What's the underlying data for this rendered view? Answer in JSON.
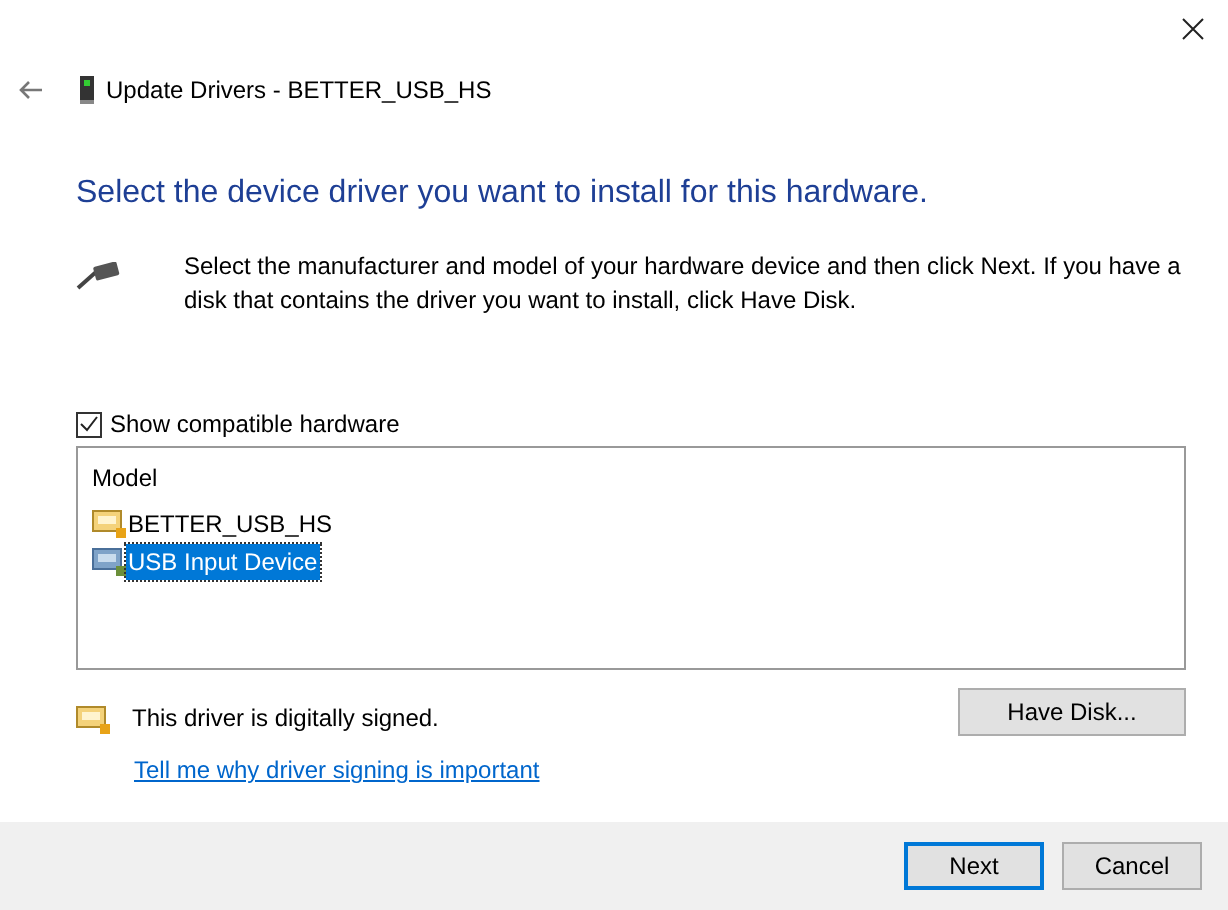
{
  "window": {
    "title": "Update Drivers - BETTER_USB_HS"
  },
  "heading": "Select the device driver you want to install for this hardware.",
  "description": "Select the manufacturer and model of your hardware device and then click Next. If you have a disk that contains the driver you want to install, click Have Disk.",
  "show_compatible": {
    "label": "Show compatible hardware",
    "checked": true
  },
  "model_list": {
    "column": "Model",
    "items": [
      {
        "label": "BETTER_USB_HS",
        "selected": false
      },
      {
        "label": "USB Input Device",
        "selected": true
      }
    ]
  },
  "signing": {
    "text": "This driver is digitally signed.",
    "link": "Tell me why driver signing is important"
  },
  "have_disk_button": "Have Disk...",
  "buttons": [
    {
      "label": "Next",
      "default": true
    },
    {
      "label": "Cancel",
      "default": false
    }
  ]
}
